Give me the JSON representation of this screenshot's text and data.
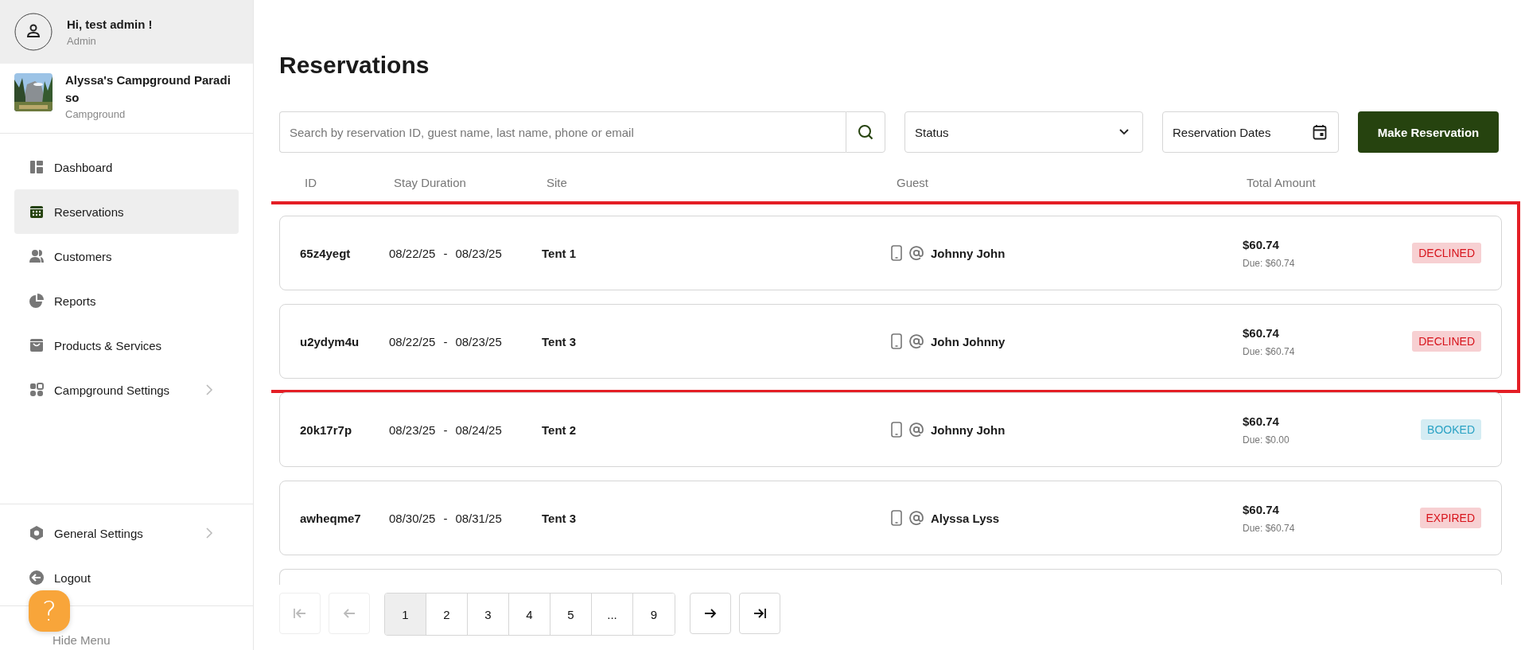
{
  "user": {
    "greeting": "Hi, test admin !",
    "role": "Admin"
  },
  "campground": {
    "name": "Alyssa's Campground Paradiso",
    "type": "Campground"
  },
  "nav": [
    {
      "label": "Dashboard",
      "selected": false,
      "has_submenu": false
    },
    {
      "label": "Reservations",
      "selected": true,
      "has_submenu": false
    },
    {
      "label": "Customers",
      "selected": false,
      "has_submenu": false
    },
    {
      "label": "Reports",
      "selected": false,
      "has_submenu": false
    },
    {
      "label": "Products & Services",
      "selected": false,
      "has_submenu": false
    },
    {
      "label": "Campground Settings",
      "selected": false,
      "has_submenu": true
    }
  ],
  "bottom_nav": [
    {
      "label": "General Settings",
      "has_submenu": true
    },
    {
      "label": "Logout",
      "has_submenu": false
    }
  ],
  "hide_menu": "Hide Menu",
  "help_button": "?",
  "title": "Reservations",
  "search": {
    "placeholder": "Search by reservation ID, guest name, last name, phone or email"
  },
  "status_filter": "Status",
  "date_filter": "Reservation Dates",
  "make_button": "Make Reservation",
  "columns": [
    "ID",
    "Stay Duration",
    "Site",
    "Guest",
    "Total Amount"
  ],
  "rows": [
    {
      "id": "65z4yegt",
      "start": "08/22/25",
      "sep": "-",
      "end": "08/23/25",
      "site": "Tent 1",
      "guest": "Johnny John",
      "total": "$60.74",
      "due": "Due: $60.74",
      "status": "DECLINED",
      "color": "#d7141c",
      "highlighted": true
    },
    {
      "id": "u2ydym4u",
      "start": "08/22/25",
      "sep": "-",
      "end": "08/23/25",
      "site": "Tent 3",
      "guest": "John Johnny",
      "total": "$60.74",
      "due": "Due: $60.74",
      "status": "DECLINED",
      "color": "#d7141c",
      "highlighted": true
    },
    {
      "id": "20k17r7p",
      "start": "08/23/25",
      "sep": "-",
      "end": "08/24/25",
      "site": "Tent 2",
      "guest": "Johnny John",
      "total": "$60.74",
      "due": "Due: $0.00",
      "status": "BOOKED",
      "color": "#2aa2c4",
      "highlighted": false
    },
    {
      "id": "awheqme7",
      "start": "08/30/25",
      "sep": "-",
      "end": "08/31/25",
      "site": "Tent 3",
      "guest": "Alyssa Lyss",
      "total": "$60.74",
      "due": "Due: $60.74",
      "status": "EXPIRED",
      "color": "#d7141c",
      "highlighted": false
    }
  ],
  "pagination": {
    "first_disabled": true,
    "prev_disabled": true,
    "next_disabled": false,
    "last_disabled": false,
    "pages": [
      {
        "label": "1",
        "selected": true
      },
      {
        "label": "2",
        "selected": false
      },
      {
        "label": "3",
        "selected": false
      },
      {
        "label": "4",
        "selected": false
      },
      {
        "label": "5",
        "selected": false
      },
      {
        "label": "...",
        "selected": false
      },
      {
        "label": "9",
        "selected": false
      }
    ]
  }
}
